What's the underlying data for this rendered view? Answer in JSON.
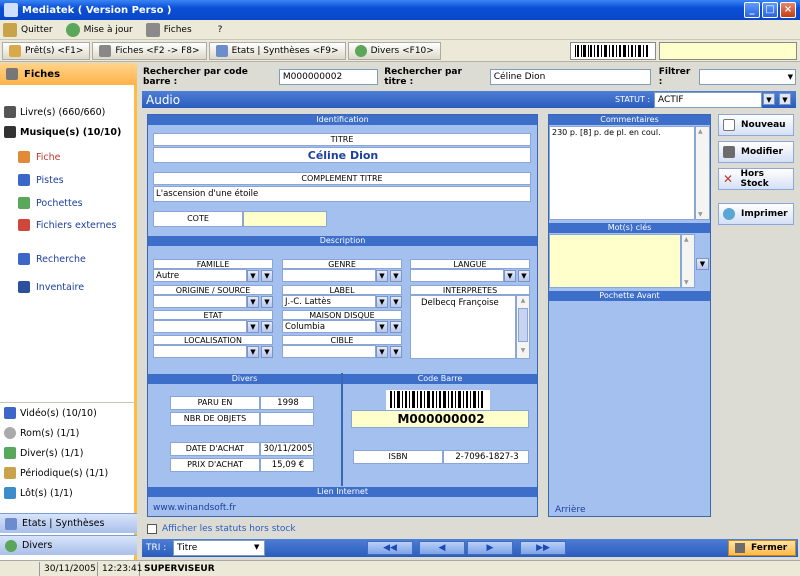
{
  "window": {
    "title": "Mediatek ( Version Perso )"
  },
  "menu": {
    "quitter": "Quitter",
    "mise_a_jour": "Mise à jour",
    "fiches": "Fiches",
    "help": "?"
  },
  "nav": {
    "prets": "Prêt(s) <F1>",
    "fiches": "Fiches <F2 -> F8>",
    "etats": "Etats | Synthèses <F9>",
    "divers": "Divers <F10>"
  },
  "sidebar": {
    "header": "Fiches",
    "livres": "Livre(s) (660/660)",
    "musique": "Musique(s) (10/10)",
    "sub": [
      "Fiche",
      "Pistes",
      "Pochettes",
      "Fichiers externes",
      "Recherche",
      "Inventaire"
    ],
    "others": [
      "Vidéo(s) (10/10)",
      "Rom(s) (1/1)",
      "Diver(s) (1/1)",
      "Périodique(s) (1/1)",
      "Lôt(s) (1/1)"
    ],
    "btn_etats": "Etats | Synthèses",
    "btn_divers": "Divers"
  },
  "search": {
    "code_label": "Rechercher par code barre :",
    "code_value": "M000000002",
    "titre_label": "Rechercher par titre :",
    "titre_value": "Céline Dion",
    "filtrer_label": "Filtrer :"
  },
  "section": {
    "title": "Audio",
    "statut_label": "STATUT :",
    "statut_value": "ACTIF"
  },
  "identification": {
    "head": "Identification",
    "titre_label": "TITRE",
    "titre_value": "Céline Dion",
    "complement_label": "COMPLEMENT TITRE",
    "complement_value": "L'ascension d'une étoile",
    "cote_label": "COTE"
  },
  "description": {
    "head": "Description",
    "famille": "FAMILLE",
    "famille_value": "Autre",
    "genre": "GENRE",
    "langue": "LANGUE",
    "origine": "ORIGINE / SOURCE",
    "label": "LABEL",
    "label_value": "J.-C. Lattès",
    "interpretes": "INTERPRETES",
    "interpretes_value": "Delbecq Françoise",
    "etat": "ETAT",
    "maison": "MAISON DISQUE",
    "maison_value": "Columbia",
    "localisation": "LOCALISATION",
    "cible": "CIBLE"
  },
  "divers": {
    "head": "Divers",
    "paru_label": "PARU EN",
    "paru_value": "1998",
    "nbr_label": "NBR DE OBJETS",
    "date_label": "DATE D'ACHAT",
    "date_value": "30/11/2005",
    "prix_label": "PRIX D'ACHAT",
    "prix_value": "15,09 €"
  },
  "codebarre": {
    "head": "Code Barre",
    "value": "M000000002",
    "isbn_label": "ISBN",
    "isbn_value": "2-7096-1827-3"
  },
  "lien": {
    "head": "Lien Internet",
    "url": "www.winandsoft.fr"
  },
  "commentaires": {
    "head": "Commentaires",
    "text": "230 p. [8] p. de pl. en coul."
  },
  "motscles": {
    "head": "Mot(s) clés"
  },
  "pochette": {
    "head": "Pochette Avant",
    "arriere": "Arrière"
  },
  "actions": {
    "nouveau": "Nouveau",
    "modifier": "Modifier",
    "hors_stock": "Hors Stock",
    "imprimer": "Imprimer"
  },
  "checkbox": {
    "label": "Afficher les statuts hors stock"
  },
  "bottom": {
    "tri_label": "TRI :",
    "tri_value": "Titre",
    "fermer": "Fermer"
  },
  "statusbar": {
    "date": "30/11/2005",
    "time": "12:23:41",
    "user": "SUPERVISEUR"
  },
  "colors": {
    "titlebar": "#0a4fd6",
    "accent": "#ffb24a",
    "panel_blue": "#a3c0ee",
    "header_blue": "#3d6ec9"
  }
}
